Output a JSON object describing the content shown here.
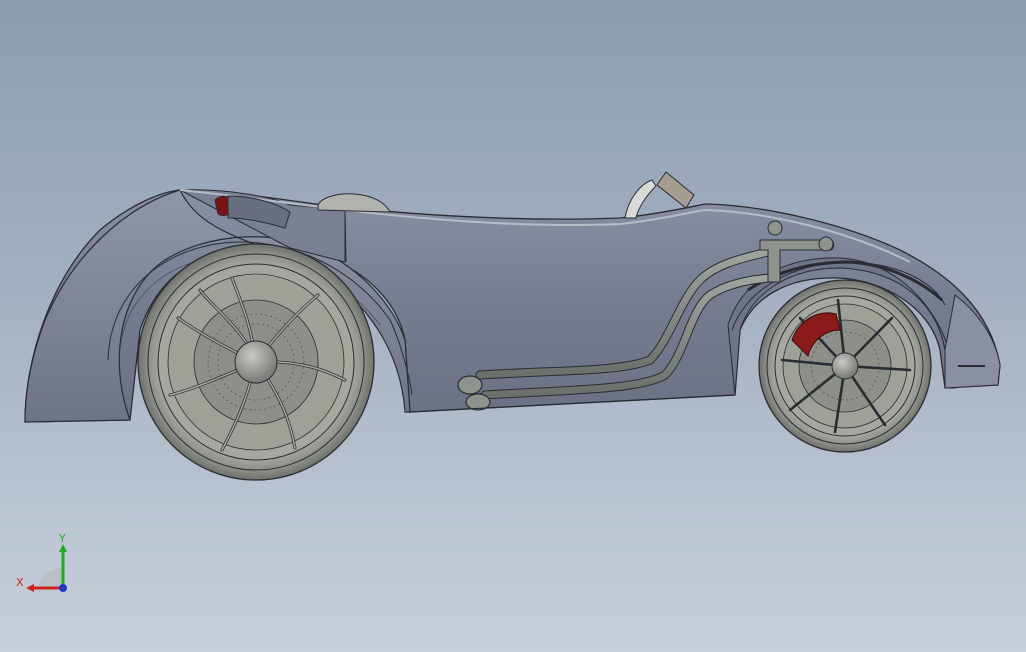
{
  "viewport": {
    "background_top": "#8e9db2",
    "background_bottom": "#c7cfda"
  },
  "model": {
    "body_color": "#7d8396",
    "wheel_color": "#9a9d96",
    "brake_caliper_color": "#8b1a1a",
    "outline_color": "#2a2c33"
  },
  "triad": {
    "x_label": "X",
    "y_label": "Y",
    "x_color": "#cc2222",
    "y_color": "#22aa22",
    "z_color": "#2233cc"
  }
}
